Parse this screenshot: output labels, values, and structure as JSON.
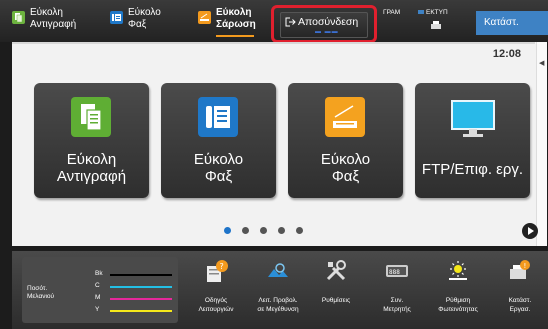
{
  "top_bar": {
    "shortcuts": [
      {
        "line1": "Εύκολη",
        "line2": "Αντιγραφή",
        "color": "#6db33f"
      },
      {
        "line1": "Εύκολο",
        "line2": "Φαξ",
        "color": "#1f78c8"
      },
      {
        "line1": "Εύκολη",
        "line2": "Σάρωση",
        "color": "#f39a1e"
      }
    ],
    "logout_label": "Αποσύνδεση",
    "tab_program": "ΓΡΑΜ",
    "tab_print": "ΕΚΤΥΠ",
    "job_status_label": "Κατάστ. Εργασ."
  },
  "main": {
    "clock": "12:08",
    "tiles": [
      {
        "line1": "Εύκολη",
        "line2": "Αντιγραφή",
        "icon": "copy-icon"
      },
      {
        "line1": "Εύκολο",
        "line2": "Φαξ",
        "icon": "fax-icon"
      },
      {
        "line1": "Εύκολο",
        "line2": "Φαξ",
        "icon": "scan-icon"
      },
      {
        "line1": "FTP/Επιφ. εργ.",
        "line2": "",
        "icon": "monitor-icon"
      }
    ],
    "page_count": 5,
    "current_page": 1
  },
  "bottom_bar": {
    "toner": {
      "title_line1": "Ποσότ.",
      "title_line2": "Μελανιού",
      "colors": [
        {
          "name": "Bk",
          "color": "#000000"
        },
        {
          "name": "C",
          "color": "#24c0e6"
        },
        {
          "name": "M",
          "color": "#e6289b"
        },
        {
          "name": "Y",
          "color": "#f5e81a"
        }
      ]
    },
    "items": [
      {
        "line1": "Οδηγός",
        "line2": "Λειτουργιών",
        "icon": "guide-icon"
      },
      {
        "line1": "Λειτ. Προβολ.",
        "line2": "σε Μεγέθυνση",
        "icon": "magnify-icon"
      },
      {
        "line1": "Ρυθμίσεις",
        "line2": "",
        "icon": "settings-icon"
      },
      {
        "line1": "Συν.",
        "line2": "Μετρητής",
        "icon": "counter-icon"
      },
      {
        "line1": "Ρύθμιση",
        "line2": "Φωτεινότητας",
        "icon": "brightness-icon"
      },
      {
        "line1": "Κατάστ.",
        "line2": "Εργασ.",
        "icon": "job-status-icon"
      }
    ]
  }
}
